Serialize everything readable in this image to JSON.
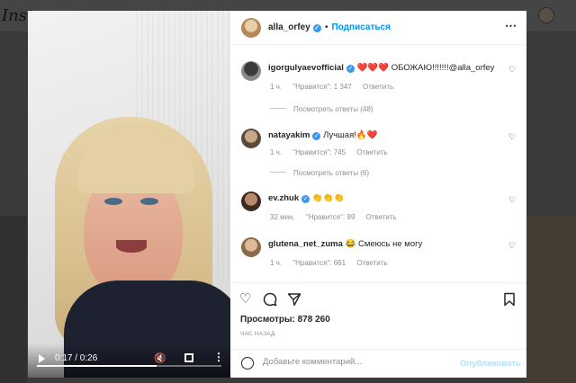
{
  "background": {
    "logo_text": "Insta"
  },
  "video": {
    "time": "0:17 / 0:26",
    "progress": 0.65
  },
  "post": {
    "username": "alla_orfey",
    "dot": "•",
    "follow_label": "Подписаться",
    "views_label": "Просмотры: 878 260",
    "time_ago": "ЧАС НАЗАД",
    "comment_placeholder": "Добавьте комментарий...",
    "publish_label": "Опубликовать"
  },
  "comments": [
    {
      "user": "igorgulyaevofficial",
      "text": "❤️❤️❤️ ОБОЖАЮ!!!!!!!@alla_orfey",
      "time": "1 ч.",
      "likes": "\"Нравится\": 1 347",
      "reply": "Ответить",
      "replies": "Посмотреть ответы (48)",
      "verified": true
    },
    {
      "user": "natayakim",
      "text": "Лучшая!🔥❤️",
      "time": "1 ч.",
      "likes": "\"Нравится\": 745",
      "reply": "Ответить",
      "replies": "Посмотреть ответы (6)",
      "verified": true
    },
    {
      "user": "ev.zhuk",
      "text": "👏👏👏",
      "time": "32 мин.",
      "likes": "\"Нравится\": 99",
      "reply": "Ответить",
      "verified": true
    },
    {
      "user": "glutena_net_zuma",
      "text": "😂 Смеюсь не могу",
      "time": "1 ч.",
      "likes": "\"Нравится\": 661",
      "reply": "Ответить",
      "verified": false
    }
  ],
  "icons": {
    "heart": "heart-icon",
    "comment": "comment-icon",
    "share": "share-icon",
    "save": "bookmark-icon",
    "verified": "verified-badge-icon"
  },
  "colors": {
    "link": "#0095f6",
    "verified": "#3897f0",
    "meta_text": "#8e8e8e"
  }
}
